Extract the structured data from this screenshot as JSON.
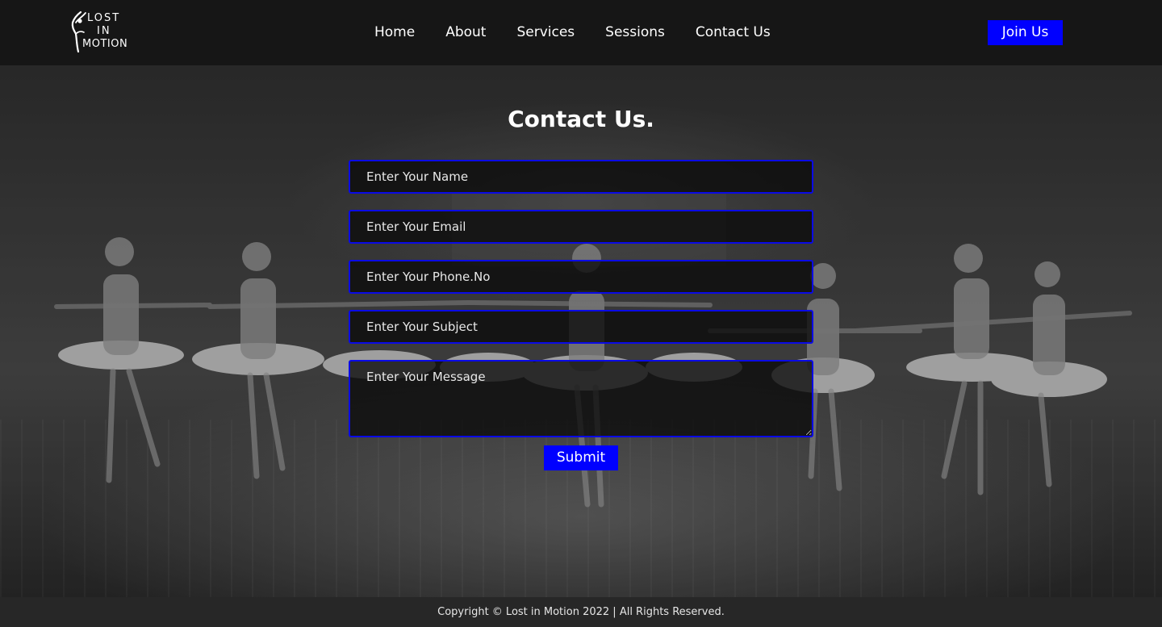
{
  "header": {
    "logo": {
      "line1": "LOST",
      "line2": "IN",
      "line3": "MOTION",
      "icon": "dancer-icon"
    },
    "nav": [
      {
        "label": "Home"
      },
      {
        "label": "About"
      },
      {
        "label": "Services"
      },
      {
        "label": "Sessions"
      },
      {
        "label": "Contact Us"
      }
    ],
    "join_label": "Join Us"
  },
  "contact": {
    "title": "Contact Us.",
    "fields": {
      "name_placeholder": "Enter Your Name",
      "email_placeholder": "Enter Your Email",
      "phone_placeholder": "Enter Your Phone.No",
      "subject_placeholder": "Enter Your Subject",
      "message_placeholder": "Enter Your Message"
    },
    "submit_label": "Submit"
  },
  "footer": {
    "copyright": "Copyright © Lost in Motion 2022 | All Rights Reserved."
  },
  "colors": {
    "accent": "#0000ff",
    "header_bg": "#161616",
    "footer_bg": "#272727",
    "text": "#ffffff"
  }
}
